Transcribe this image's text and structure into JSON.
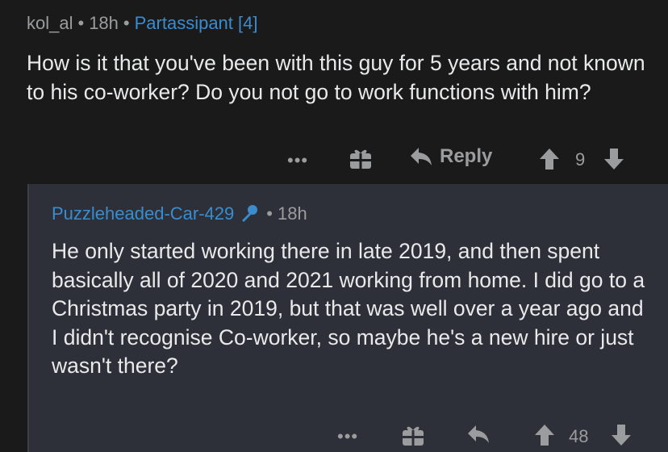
{
  "comment1": {
    "username": "kol_al",
    "separator": "•",
    "age": "18h",
    "flair": "Partassipant [4]",
    "body": "How is it that you've been with this guy for 5 years and not known to his co-worker?  Do you not go to work functions with him?",
    "more_label": "•••",
    "reply_label": "Reply",
    "score": "9"
  },
  "comment2": {
    "username": "Puzzleheaded-Car-429",
    "separator": "•",
    "age": "18h",
    "body": "He only started working there in late 2019, and then spent basically all of 2020 and 2021 working from home. I did go to a Christmas party in 2019, but that was well over a year ago and I didn't recognise Co-worker, so maybe he's a new hire or just wasn't there?",
    "more_label": "•••",
    "score": "48"
  },
  "colors": {
    "background_top": "#1a1a1b",
    "background_reply": "#2d3038",
    "link_blue": "#3a8ccf",
    "muted": "#9a9c9e",
    "text": "#e8e9ea"
  },
  "icons": [
    "award-icon",
    "reply-arrow-icon",
    "upvote-icon",
    "downvote-icon",
    "op-mic-icon"
  ]
}
